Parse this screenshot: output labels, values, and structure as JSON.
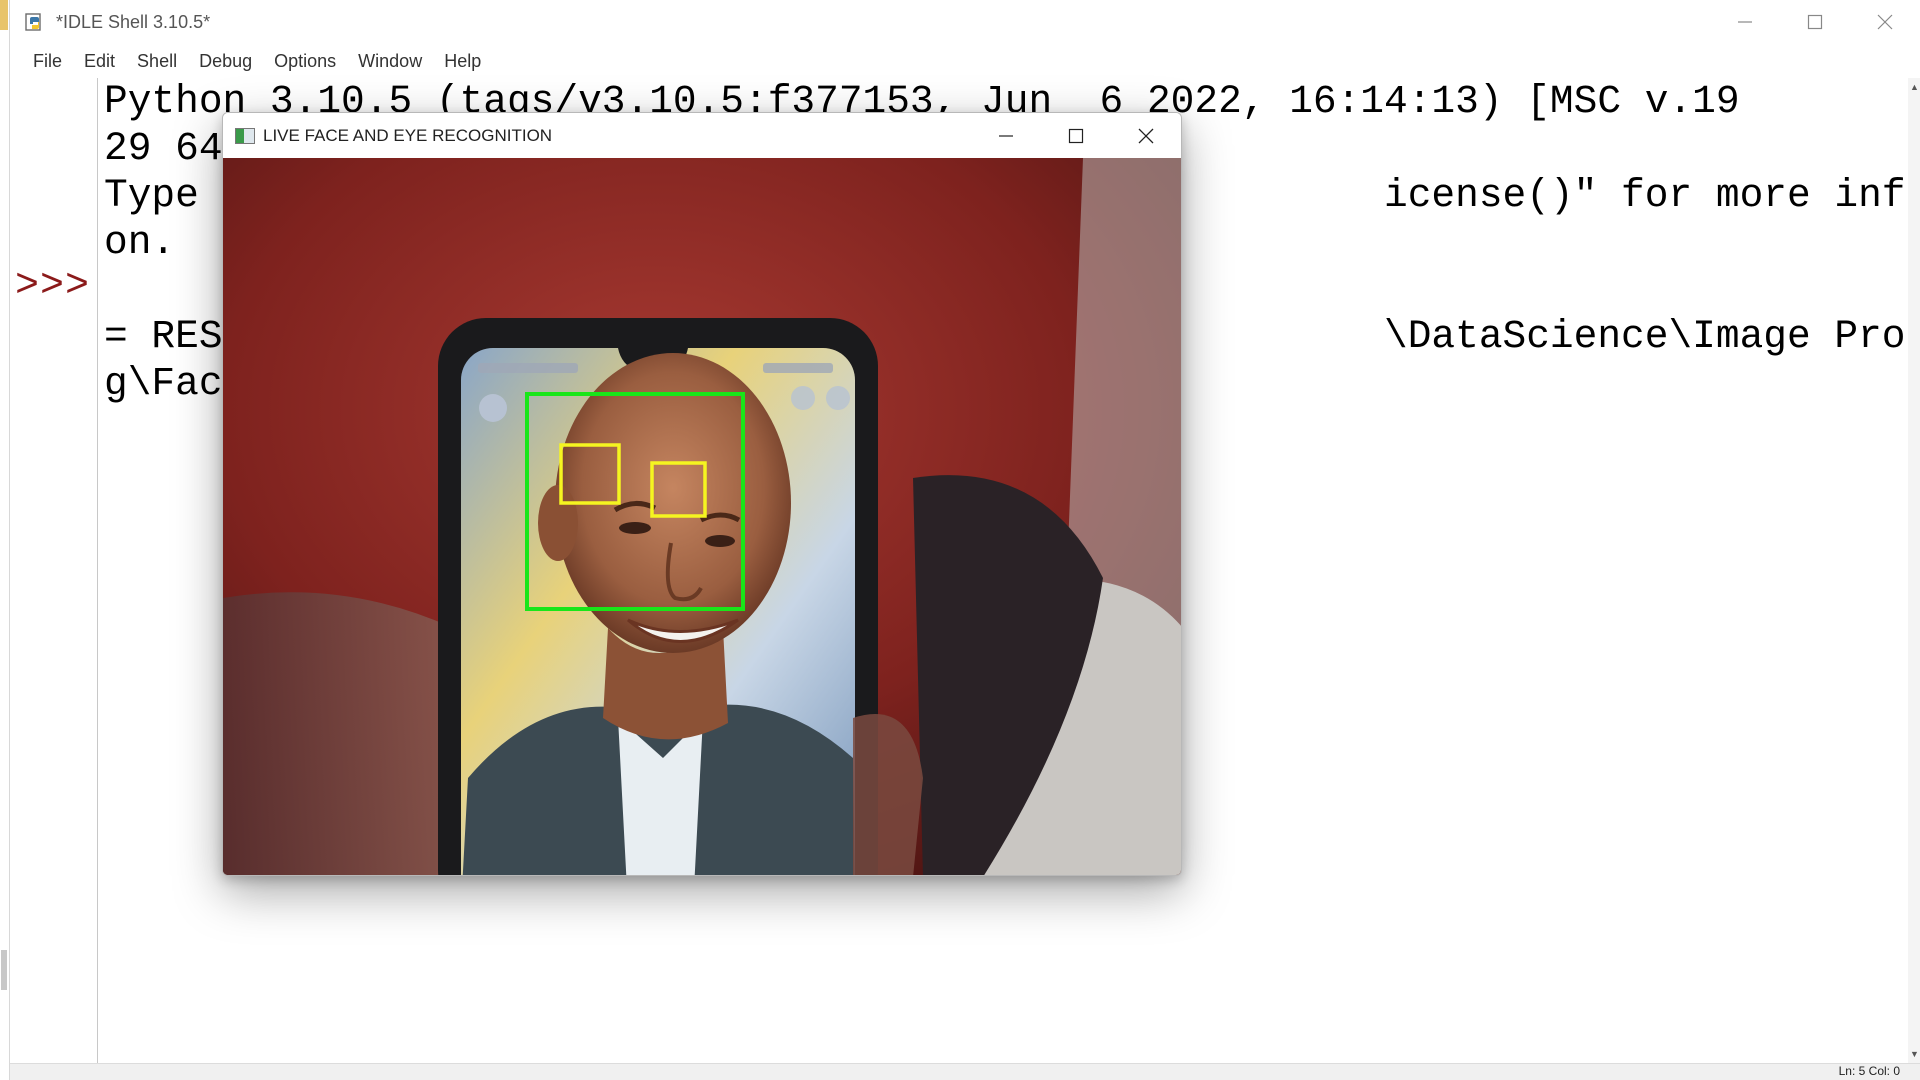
{
  "window": {
    "title": "*IDLE Shell 3.10.5*"
  },
  "menu": [
    "File",
    "Edit",
    "Shell",
    "Debug",
    "Options",
    "Window",
    "Help"
  ],
  "shell": {
    "prompt": ">>>",
    "lines": [
      "Python 3.10.5 (tags/v3.10.5:f377153, Jun  6 2022, 16:14:13) [MSC v.19",
      "29 64",
      "Type                                                  icense()\" for more informati",
      "on.",
      "",
      "= RES                                                 \\DataScience\\Image Processin",
      "g\\Fac"
    ]
  },
  "status": {
    "position": "Ln: 5  Col: 0"
  },
  "popup": {
    "title": "LIVE FACE AND EYE RECOGNITION",
    "detections": {
      "face_color": "#19e619",
      "eye_color": "#f5f520",
      "faces": 1,
      "eyes": 2
    }
  },
  "icons": {
    "minimize": "minimize-icon",
    "maximize": "maximize-icon",
    "close": "close-icon",
    "app": "idle-app-icon",
    "popup_app": "opencv-window-icon"
  }
}
